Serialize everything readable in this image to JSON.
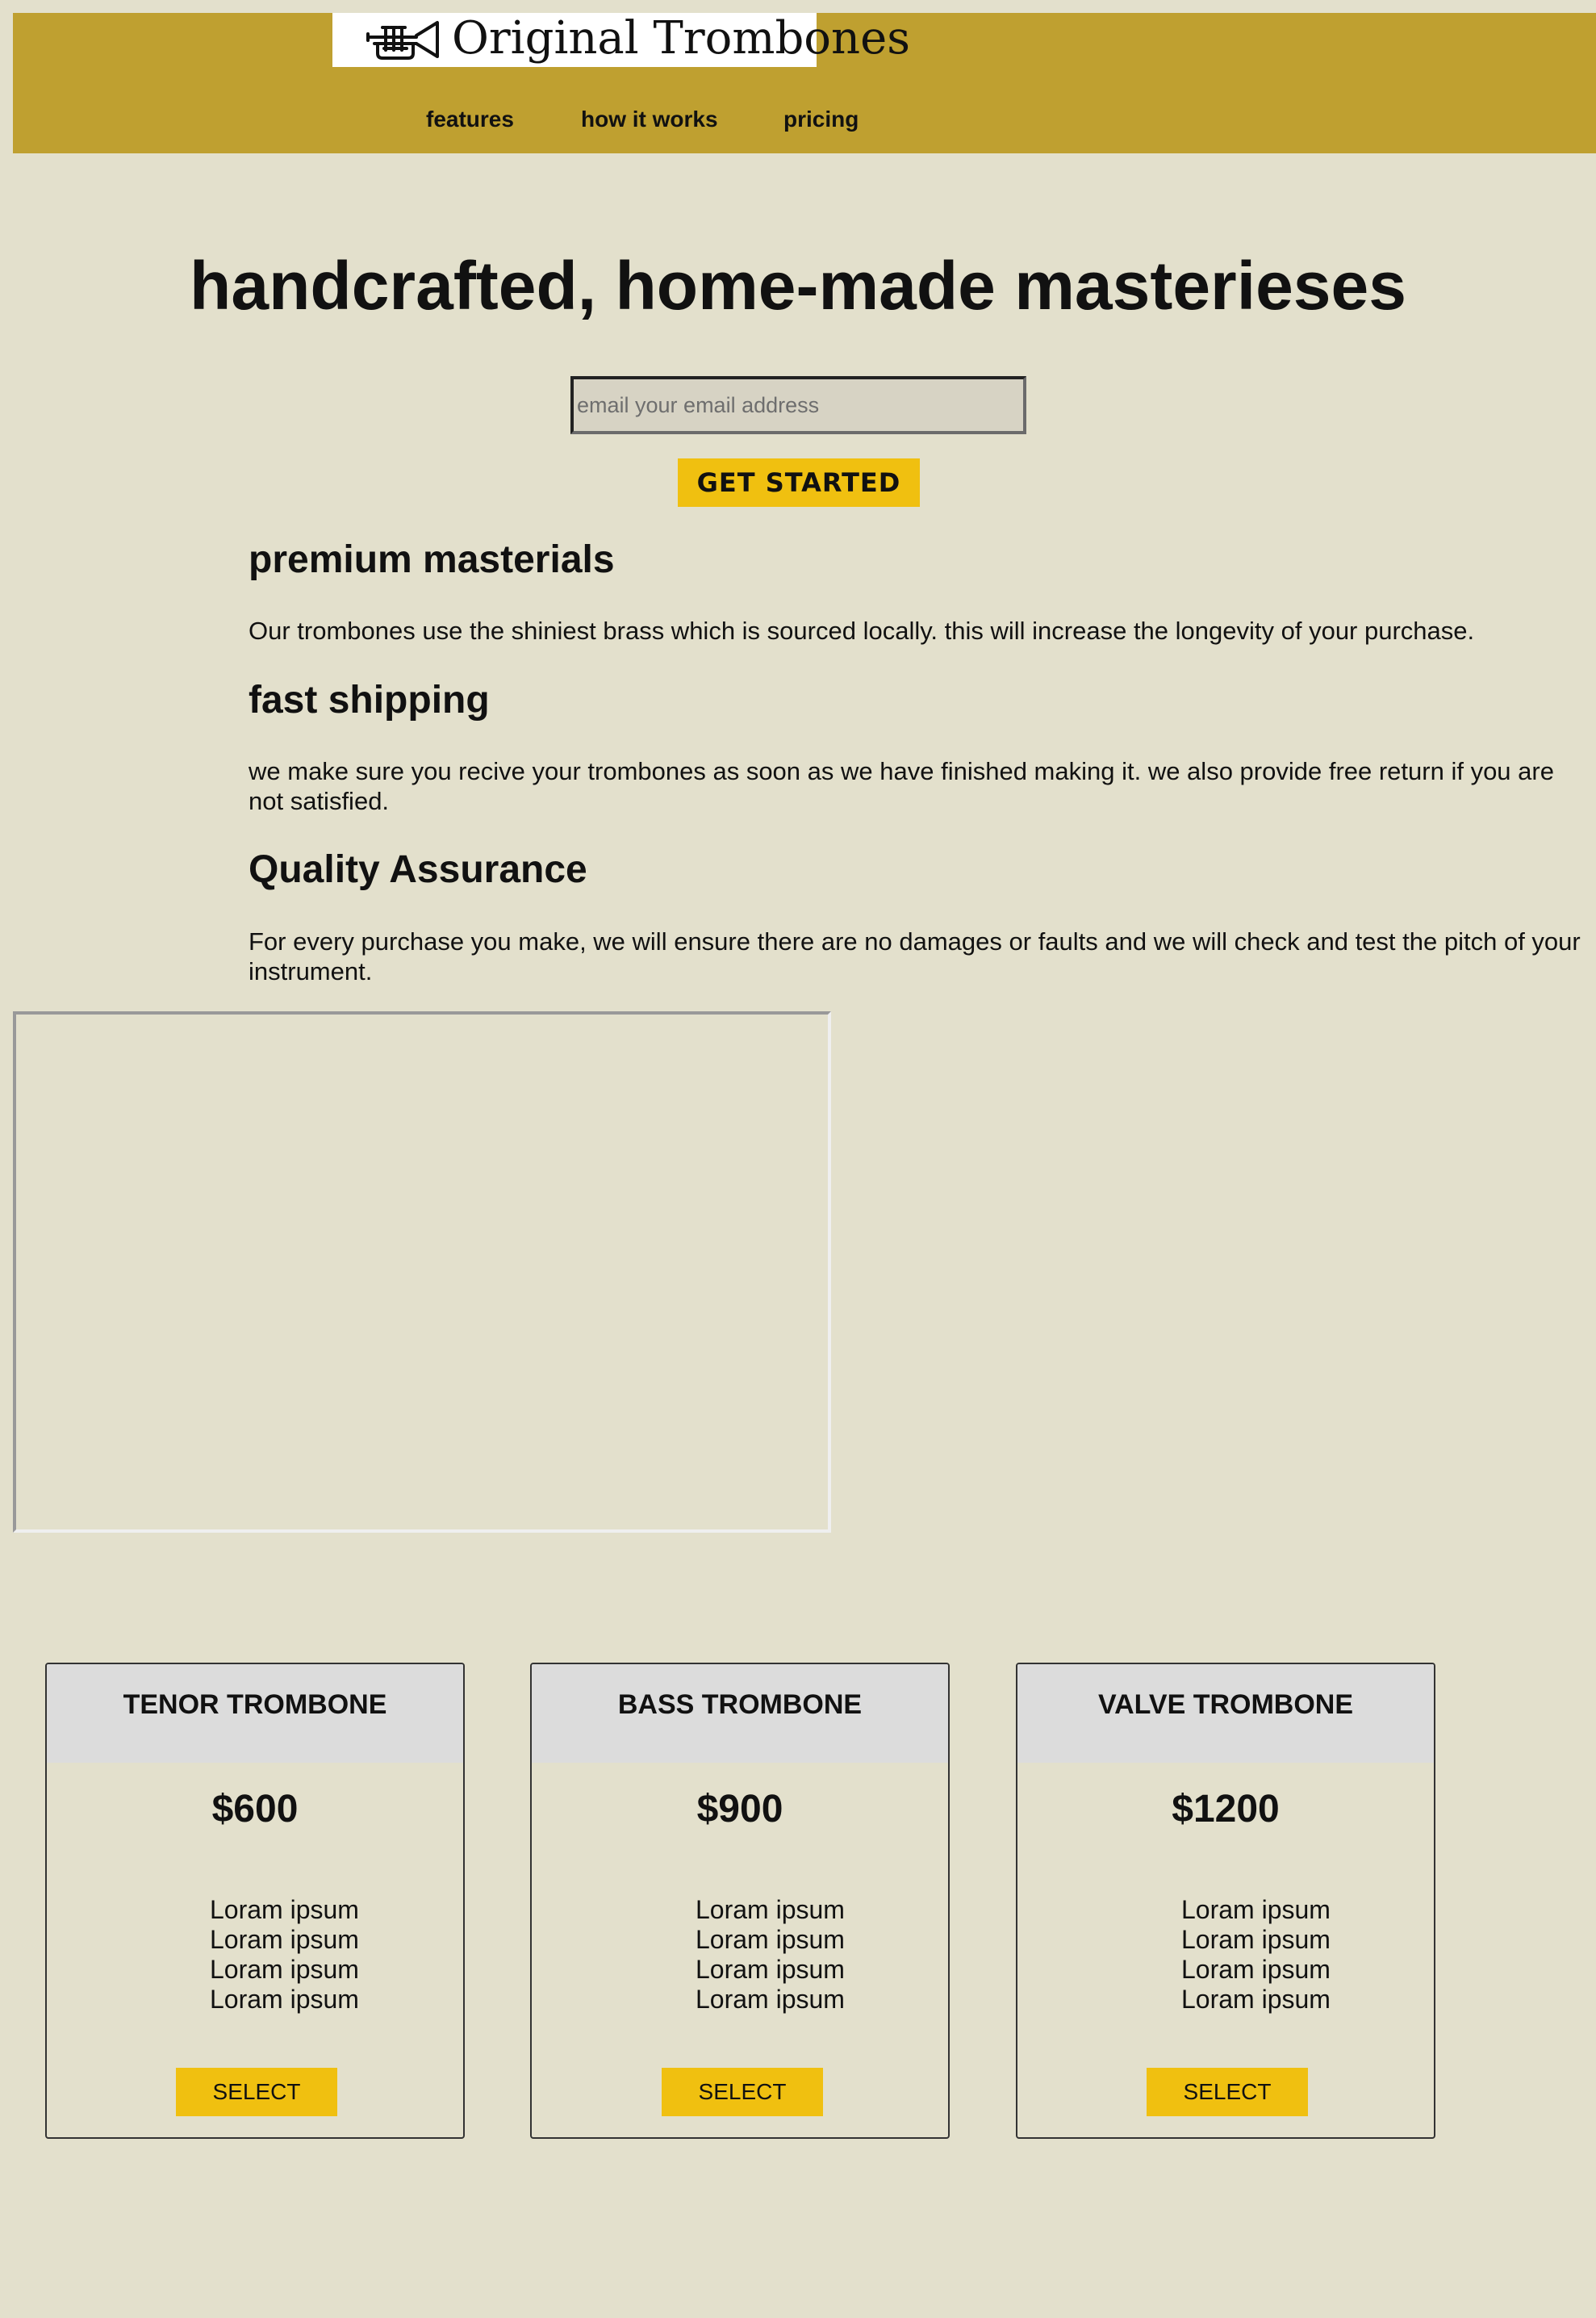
{
  "header": {
    "logo_text": "Original Trombones",
    "logo_icon": "trumpet-icon",
    "nav": [
      {
        "label": "features"
      },
      {
        "label": "how it works"
      },
      {
        "label": "pricing"
      }
    ],
    "background_color": "#bfa030"
  },
  "hero": {
    "title": "handcrafted, home-made masterieses",
    "email_placeholder": "email your email address",
    "cta_label": "GET STARTED"
  },
  "features": [
    {
      "heading": "premium masterials",
      "text": "Our trombones use the shiniest brass which is sourced locally. this will increase the longevity of your purchase."
    },
    {
      "heading": "fast shipping",
      "text": "we make sure you recive your trombones as soon as we have finished making it. we also provide free return if you are not satisfied."
    },
    {
      "heading": "Quality Assurance",
      "text": "For every purchase you make, we will ensure there are no damages or faults and we will check and test the pitch of your instrument."
    }
  ],
  "pricing": [
    {
      "title": "TENOR TROMBONE",
      "price": "$600",
      "features": [
        "Loram ipsum",
        "Loram ipsum",
        "Loram ipsum",
        "Loram ipsum"
      ],
      "button": "SELECT"
    },
    {
      "title": "BASS TROMBONE",
      "price": "$900",
      "features": [
        "Loram ipsum",
        "Loram ipsum",
        "Loram ipsum",
        "Loram ipsum"
      ],
      "button": "SELECT"
    },
    {
      "title": "VALVE TROMBONE",
      "price": "$1200",
      "features": [
        "Loram ipsum",
        "Loram ipsum",
        "Loram ipsum",
        "Loram ipsum"
      ],
      "button": "SELECT"
    }
  ],
  "colors": {
    "page_background": "#e3e0cc",
    "accent_button": "#f0c010",
    "card_header": "#dcdcdc"
  }
}
